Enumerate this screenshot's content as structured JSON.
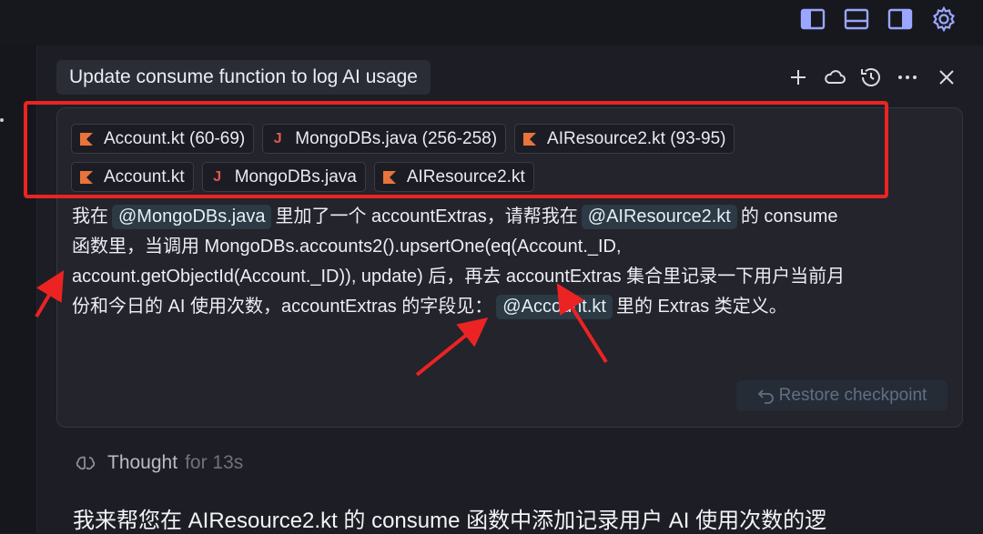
{
  "chat": {
    "title": "Update consume function to log AI usage",
    "actions": [
      "new-chat",
      "cloud",
      "history",
      "more",
      "close"
    ]
  },
  "context_chips": {
    "row1": [
      {
        "icon": "kotlin-icon",
        "label": "Account.kt (60-69)"
      },
      {
        "icon": "java-icon",
        "label": "MongoDBs.java (256-258)"
      },
      {
        "icon": "kotlin-icon",
        "label": "AIResource2.kt (93-95)"
      }
    ],
    "row2": [
      {
        "icon": "kotlin-icon",
        "label": "Account.kt"
      },
      {
        "icon": "java-icon",
        "label": "MongoDBs.java"
      },
      {
        "icon": "kotlin-icon",
        "label": "AIResource2.kt"
      }
    ]
  },
  "message": {
    "l1_a": "我在",
    "mention1": "@MongoDBs.java",
    "l1_b": "里加了一个 accountExtras，请帮我在",
    "mention2": "@AIResource2.kt",
    "l1_c": "的 consume",
    "line2": "函数里，当调用 MongoDBs.accounts2().upsertOne(eq(Account._ID,",
    "line3": "account.getObjectId(Account._ID)), update) 后，再去 accountExtras 集合里记录一下用户当前月",
    "l4_a": "份和今日的 AI 使用次数，accountExtras 的字段见：",
    "mention3": "@Account.kt",
    "l4_b": "里的 Extras 类定义。"
  },
  "restore_label": "Restore checkpoint",
  "thought": {
    "label": "Thought",
    "duration": "for 13s"
  },
  "reply": "我来帮您在 AIResource2.kt 的 consume 函数中添加记录用户 AI 使用次数的逻",
  "colors": {
    "annotation_red": "#ec2323",
    "kotlin_orange": "#e8743b",
    "java_red": "#e05a4f",
    "accent_blue": "#9aa6ff"
  }
}
